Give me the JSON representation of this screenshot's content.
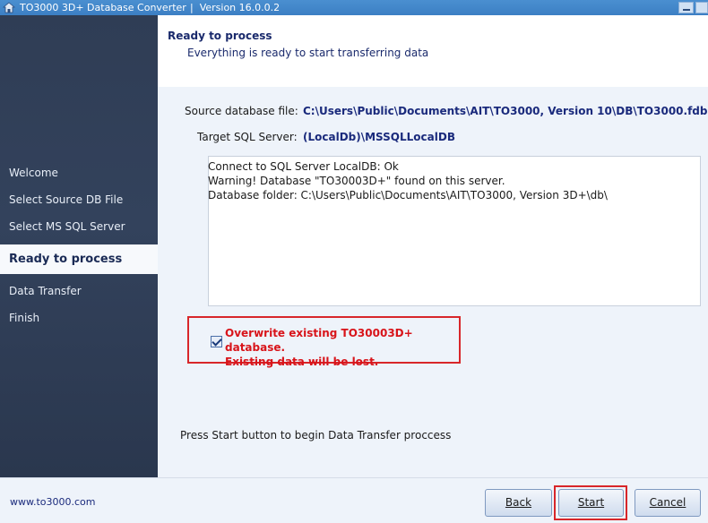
{
  "window": {
    "title": "TO3000 3D+ Database Converter",
    "version": "|  Version 16.0.0.2",
    "icon": "app-icon"
  },
  "sidebar": {
    "items": [
      {
        "label": "Welcome",
        "active": false
      },
      {
        "label": "Select Source DB File",
        "active": false
      },
      {
        "label": "Select MS SQL Server LocalDB",
        "active": false
      },
      {
        "label": "Ready to process",
        "active": true
      },
      {
        "label": "Data Transfer",
        "active": false
      },
      {
        "label": "Finish",
        "active": false
      }
    ]
  },
  "header": {
    "title": "Ready to process",
    "subtitle": "Everything is ready to start transferring data"
  },
  "main": {
    "source_label": "Source database file:",
    "source_value": "C:\\Users\\Public\\Documents\\AIT\\TO3000, Version 10\\DB\\TO3000.fdb",
    "target_label": "Target SQL Server:",
    "target_value": "(LocalDb)\\MSSQLLocalDB",
    "log_lines": [
      "Connect to SQL Server LocalDB: Ok",
      "Warning! Database \"TO30003D+\" found on this server.",
      "Database folder: C:\\Users\\Public\\Documents\\AIT\\TO3000, Version 3D+\\db\\"
    ],
    "overwrite_checked": true,
    "overwrite_line1": "Overwrite existing TO30003D+ database.",
    "overwrite_line2": "Existing data will be lost.",
    "press_start_text": "Press Start button to begin Data Transfer proccess"
  },
  "footer": {
    "site": "www.to3000.com",
    "back_label": "Back",
    "start_label": "Start",
    "cancel_label": "Cancel"
  },
  "colors": {
    "sidebar_bg": "#2f3d55",
    "accent_navy": "#1a2a7c",
    "warning_red": "#d8141a"
  }
}
